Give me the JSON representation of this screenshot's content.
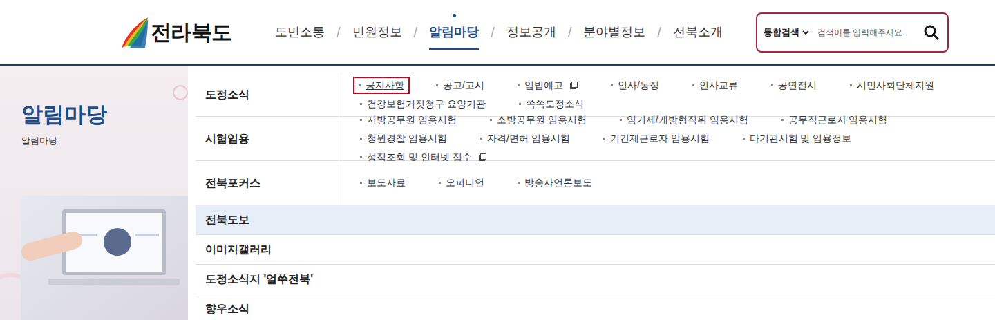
{
  "logo": {
    "text": "전라북도"
  },
  "nav_separator": "/",
  "nav": [
    {
      "label": "도민소통",
      "selected": false
    },
    {
      "label": "민원정보",
      "selected": false
    },
    {
      "label": "알림마당",
      "selected": true
    },
    {
      "label": "정보공개",
      "selected": false
    },
    {
      "label": "분야별정보",
      "selected": false
    },
    {
      "label": "전북소개",
      "selected": false
    }
  ],
  "search": {
    "scope": "통합검색",
    "placeholder": "검색어를 입력해주세요."
  },
  "side": {
    "title": "알림마당",
    "subtitle": "알림마당"
  },
  "menu": [
    {
      "label": "도정소식",
      "highlighted": false,
      "items": [
        {
          "label": "공지사항",
          "selected": true,
          "external": false
        },
        {
          "label": "공고/고시",
          "selected": false,
          "external": false
        },
        {
          "label": "입법예고",
          "selected": false,
          "external": true
        },
        {
          "label": "인사/동정",
          "selected": false,
          "external": false
        },
        {
          "label": "인사교류",
          "selected": false,
          "external": false
        },
        {
          "label": "공연전시",
          "selected": false,
          "external": false
        },
        {
          "label": "시민사회단체지원",
          "selected": false,
          "external": false
        },
        {
          "label": "건강보험거짓청구 요양기관",
          "selected": false,
          "external": false
        },
        {
          "label": "쏙쏙도정소식",
          "selected": false,
          "external": false
        }
      ]
    },
    {
      "label": "시험임용",
      "highlighted": false,
      "items": [
        {
          "label": "지방공무원 임용시험",
          "selected": false,
          "external": false
        },
        {
          "label": "소방공무원 임용시험",
          "selected": false,
          "external": false
        },
        {
          "label": "임기제/개방형직위 임용시험",
          "selected": false,
          "external": false
        },
        {
          "label": "공무직근로자 임용시험",
          "selected": false,
          "external": false
        },
        {
          "label": "청원경찰 임용시험",
          "selected": false,
          "external": false
        },
        {
          "label": "자격/면허 임용시험",
          "selected": false,
          "external": false
        },
        {
          "label": "기간제근로자 임용시험",
          "selected": false,
          "external": false
        },
        {
          "label": "타기관시험 및 임용정보",
          "selected": false,
          "external": false
        },
        {
          "label": "성적조회 및 인터넷 접수",
          "selected": false,
          "external": true
        }
      ]
    },
    {
      "label": "전북포커스",
      "highlighted": false,
      "items": [
        {
          "label": "보도자료",
          "selected": false,
          "external": false
        },
        {
          "label": "오피니언",
          "selected": false,
          "external": false
        },
        {
          "label": "방송사언론보도",
          "selected": false,
          "external": false
        }
      ]
    },
    {
      "label": "전북도보",
      "highlighted": true,
      "items": []
    },
    {
      "label": "이미지갤러리",
      "highlighted": false,
      "items": []
    },
    {
      "label": "도정소식지 '얼쑤전북'",
      "highlighted": false,
      "items": []
    },
    {
      "label": "향우소식",
      "highlighted": false,
      "items": []
    }
  ]
}
